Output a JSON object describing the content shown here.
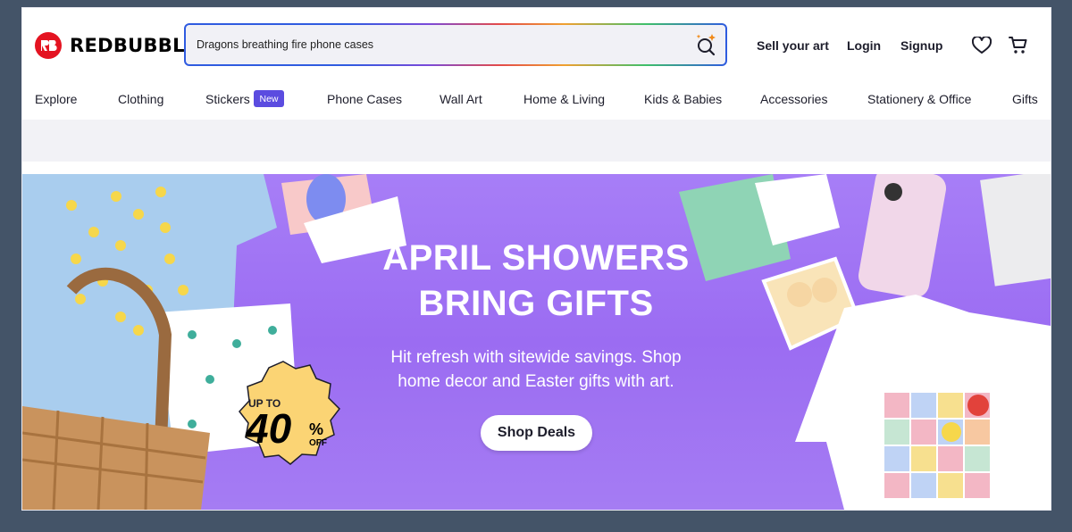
{
  "brand": {
    "name": "REDBUBBLE",
    "color": "#e41321"
  },
  "search": {
    "value": "Dragons breathing fire phone cases"
  },
  "header": {
    "sell_label": "Sell your art",
    "login_label": "Login",
    "signup_label": "Signup"
  },
  "categories": [
    "Explore",
    "Clothing",
    "Stickers",
    "Phone Cases",
    "Wall Art",
    "Home & Living",
    "Kids & Babies",
    "Accessories",
    "Stationery & Office",
    "Gifts"
  ],
  "stickers_badge": "New",
  "banner": {
    "headline_1": "APRIL SHOWERS",
    "headline_2": "BRING GIFTS",
    "sub_1": "Hit refresh with sitewide savings. Shop",
    "sub_2": "home decor and Easter gifts with art.",
    "cta": "Shop Deals",
    "promo_up_to": "UP TO",
    "promo_value": "40",
    "promo_percent": "%",
    "promo_off": "OFF"
  },
  "colors": {
    "accent": "#5b4ce0",
    "banner_purple": "#9b6cf2",
    "promo_yellow": "#fbd474"
  }
}
